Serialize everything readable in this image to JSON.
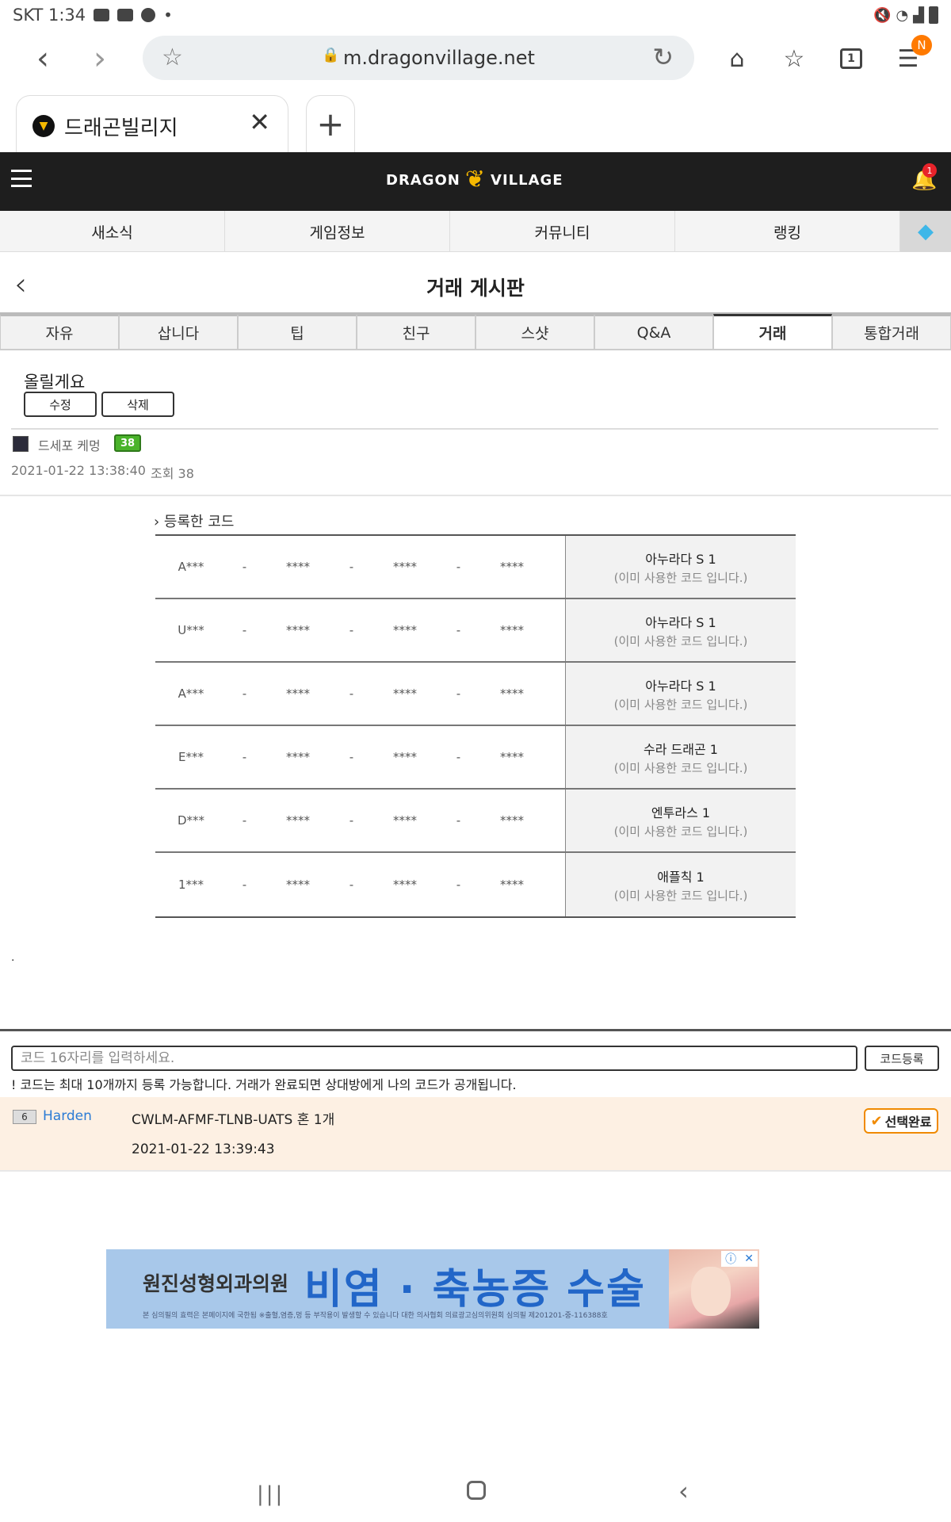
{
  "statusbar": {
    "carrier_time": "SKT 1:34",
    "dot": "•"
  },
  "browser": {
    "url": "m.dragonvillage.net",
    "tab_title": "드래곤빌리지",
    "tabs_count": "1",
    "menu_badge": "N"
  },
  "site": {
    "logo_left": "DRAGON",
    "logo_right": "VILLAGE",
    "notification_count": "1",
    "nav": [
      {
        "label": "새소식"
      },
      {
        "label": "게임정보"
      },
      {
        "label": "커뮤니티"
      },
      {
        "label": "랭킹"
      }
    ]
  },
  "board": {
    "title": "거래 게시판",
    "categories": [
      {
        "label": "자유"
      },
      {
        "label": "삽니다"
      },
      {
        "label": "팁"
      },
      {
        "label": "친구"
      },
      {
        "label": "스샷"
      },
      {
        "label": "Q&A"
      },
      {
        "label": "거래",
        "active": true
      },
      {
        "label": "통합거래"
      }
    ]
  },
  "post": {
    "title": "올릴게요",
    "edit_label": "수정",
    "delete_label": "삭제",
    "author": "드세포 케멍",
    "author_level": "38",
    "date": "2021-01-22 13:38:40",
    "views": "조회 38"
  },
  "codes": {
    "section_title": "› 등록한 코드",
    "rows": [
      {
        "seg1": "A***",
        "seg2": "****",
        "seg3": "****",
        "seg4": "****",
        "product": "아누라다 S 1",
        "status": "(이미 사용한 코드 입니다.)"
      },
      {
        "seg1": "U***",
        "seg2": "****",
        "seg3": "****",
        "seg4": "****",
        "product": "아누라다 S 1",
        "status": "(이미 사용한 코드 입니다.)"
      },
      {
        "seg1": "A***",
        "seg2": "****",
        "seg3": "****",
        "seg4": "****",
        "product": "아누라다 S 1",
        "status": "(이미 사용한 코드 입니다.)"
      },
      {
        "seg1": "E***",
        "seg2": "****",
        "seg3": "****",
        "seg4": "****",
        "product": "수라 드래곤 1",
        "status": "(이미 사용한 코드 입니다.)"
      },
      {
        "seg1": "D***",
        "seg2": "****",
        "seg3": "****",
        "seg4": "****",
        "product": "엔투라스 1",
        "status": "(이미 사용한 코드 입니다.)"
      },
      {
        "seg1": "1***",
        "seg2": "****",
        "seg3": "****",
        "seg4": "****",
        "product": "애플칙 1",
        "status": "(이미 사용한 코드 입니다.)"
      }
    ],
    "separator": "-"
  },
  "stray_dot": ".",
  "register": {
    "placeholder": "코드 16자리를 입력하세요.",
    "button_label": "코드등록",
    "notice": "! 코드는 최대 10개까지 등록 가능합니다. 거래가 완료되면 상대방에게 나의 코드가 공개됩니다."
  },
  "offer": {
    "level": "6",
    "user": "Harden",
    "code_text": "CWLM-AFMF-TLNB-UATS 혼 1개",
    "date": "2021-01-22 13:39:43",
    "select_label": "선택완료"
  },
  "ad": {
    "clinic": "원진성형외과의원",
    "headline": "비염 · 축농증 수술",
    "disclaimer": "본 심의필의 효력은 본페이지에 국한됨 ※출혈,염증,멍 등 부작용이 발생할 수 있습니다 대한 의사협회 의료광고심의위원회 심의필 제201201-중-116388호"
  }
}
